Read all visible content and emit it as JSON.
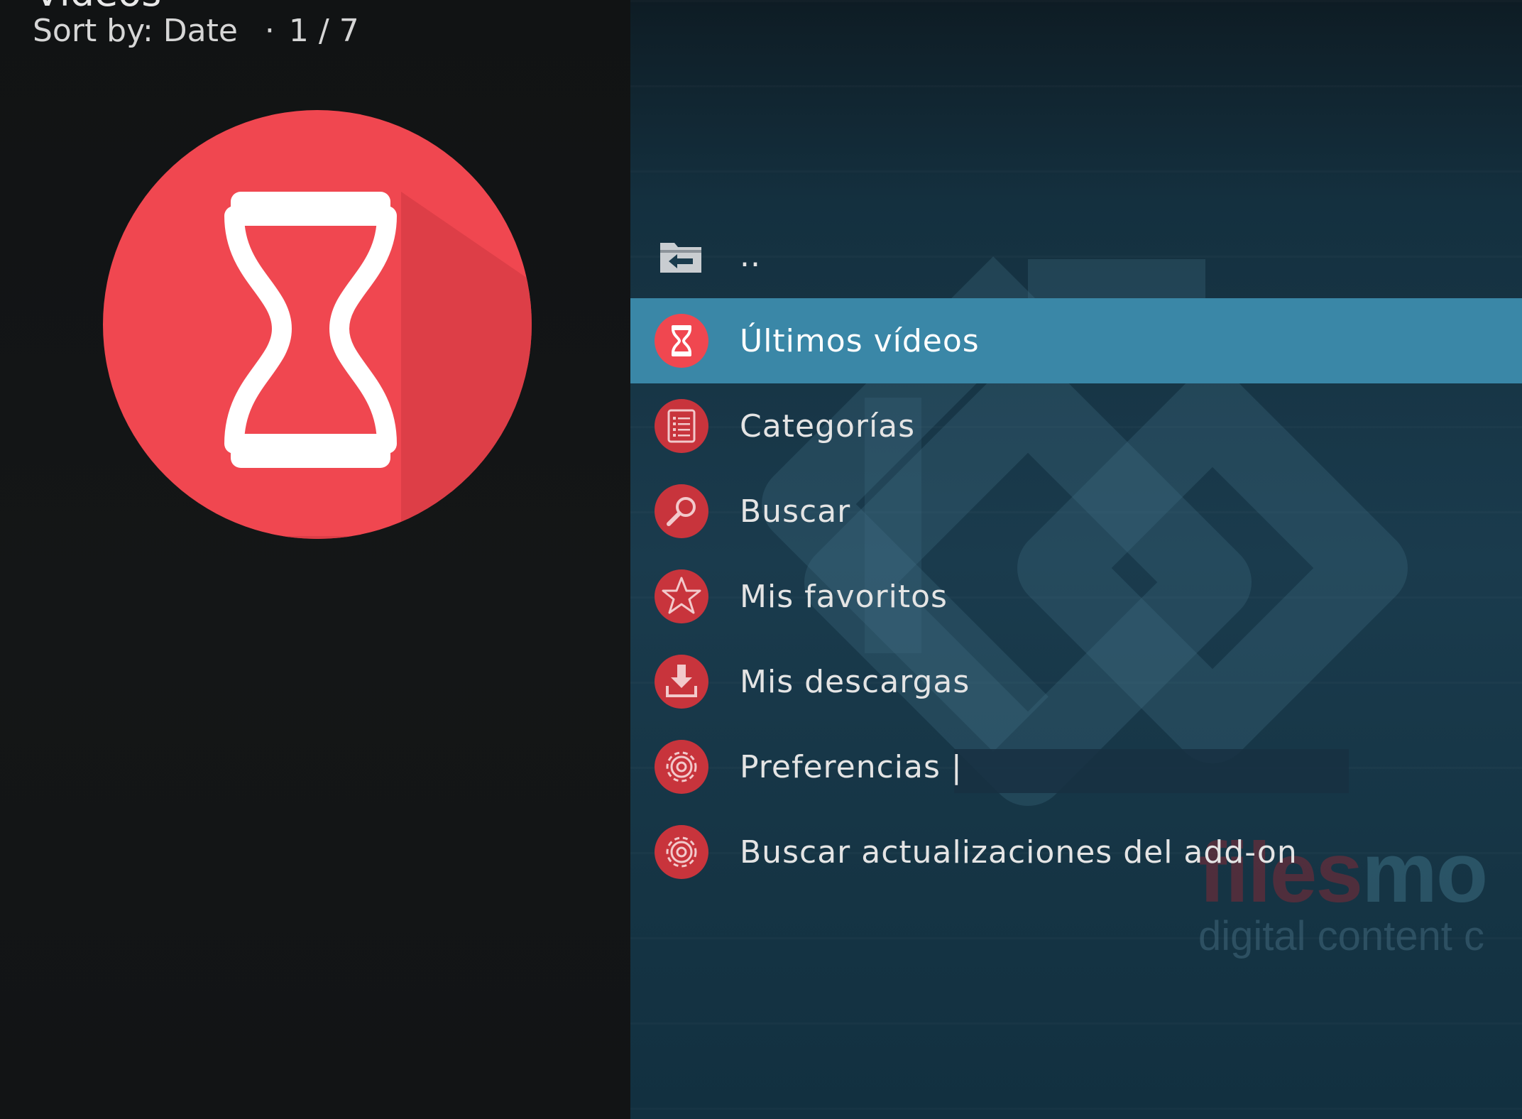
{
  "header": {
    "title": "Videos",
    "sort_label": "Sort by: Date",
    "separator": "·",
    "position": "1 / 7"
  },
  "preview": {
    "icon": "hourglass-icon",
    "color": "#f04750"
  },
  "list": {
    "items": [
      {
        "label": "..",
        "icon": "folder-back-icon"
      },
      {
        "label": "Últimos vídeos",
        "icon": "hourglass-icon",
        "selected": true
      },
      {
        "label": "Categorías",
        "icon": "list-icon"
      },
      {
        "label": "Buscar",
        "icon": "search-icon"
      },
      {
        "label": "Mis favoritos",
        "icon": "star-icon"
      },
      {
        "label": "Mis descargas",
        "icon": "download-icon"
      },
      {
        "label": "Preferencias |",
        "icon": "gear-icon"
      },
      {
        "label": "Buscar actualizaciones del add-on",
        "icon": "gear-icon"
      }
    ]
  },
  "watermark": {
    "brand_red": "files",
    "brand_teal": "mo",
    "tagline": "digital content c"
  },
  "colors": {
    "accent": "#3a87a7",
    "icon_red": "#c8343c",
    "left_bg": "#121416",
    "right_bg": "#1a3b4d"
  }
}
